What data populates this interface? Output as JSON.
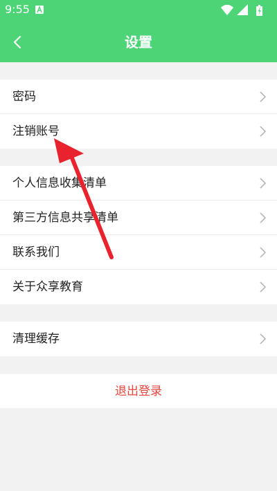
{
  "status_bar": {
    "time": "9:55",
    "notification_icon": "app-notification-icon",
    "icons": [
      "wifi-icon",
      "signal-icon",
      "battery-charging-icon"
    ]
  },
  "toolbar": {
    "back_icon": "chevron-left-icon",
    "title": "设置"
  },
  "groups": [
    {
      "items": [
        {
          "label": "密码"
        },
        {
          "label": "注销账号"
        }
      ]
    },
    {
      "items": [
        {
          "label": "个人信息收集清单"
        },
        {
          "label": "第三方信息共享清单"
        },
        {
          "label": "联系我们"
        },
        {
          "label": "关于众享教育"
        }
      ]
    },
    {
      "items": [
        {
          "label": "清理缓存"
        }
      ]
    }
  ],
  "logout": {
    "label": "退出登录"
  },
  "colors": {
    "header": "#4cd477",
    "background": "#f2f2f2",
    "logout_text": "#e8453c",
    "annotation_arrow": "#e8232d"
  },
  "annotation": {
    "icon": "red-arrow-pointer",
    "points_to": "注销账号"
  }
}
